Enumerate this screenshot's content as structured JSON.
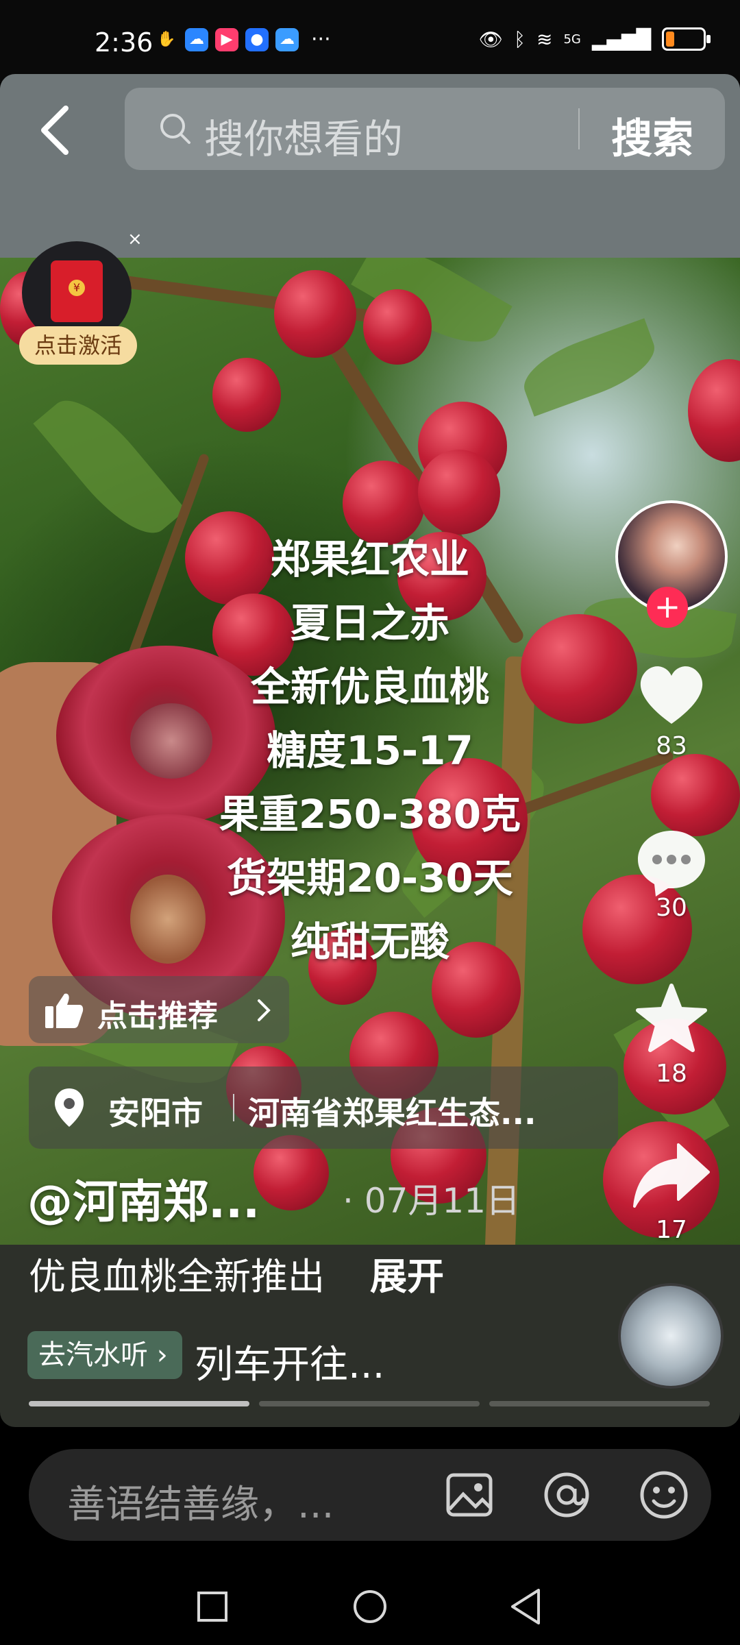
{
  "status_bar": {
    "time": "2:36",
    "more": "···",
    "network": "5G"
  },
  "search": {
    "placeholder": "搜你想看的",
    "button_label": "搜索"
  },
  "ad": {
    "close_label": "×",
    "activate_label": "点击激活"
  },
  "video": {
    "overlay_lines": [
      "郑果红农业",
      "夏日之赤",
      "全新优良血桃",
      "糖度15-17",
      "果重250-380克",
      "货架期20-30天",
      "纯甜无酸"
    ],
    "recommend_label": "点击推荐",
    "location_city": "安阳市",
    "location_place": "河南省郑果红生态...",
    "author": "@河南郑...",
    "date": "· 07月11日"
  },
  "actions": {
    "likes": "83",
    "comments": "30",
    "favorites": "18",
    "shares": "17"
  },
  "description": {
    "text": "优良血桃全新推出",
    "expand_label": "展开"
  },
  "music": {
    "tag_label": "去汽水听",
    "title": "列车开往..."
  },
  "comment": {
    "placeholder": "善语结善缘，..."
  },
  "colors": {
    "follow": "#fe2c55",
    "battery": "#ff8a1e"
  }
}
